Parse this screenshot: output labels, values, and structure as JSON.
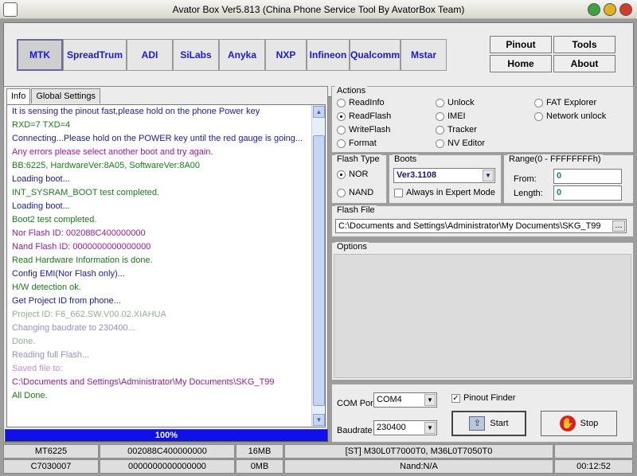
{
  "window": {
    "title": "Avator Box Ver5.813 (China Phone Service Tool By AvatorBox Team)"
  },
  "platforms": [
    "MTK",
    "SpreadTrum",
    "ADI",
    "SiLabs",
    "Anyka",
    "NXP",
    "Infineon",
    "Qualcomm",
    "Mstar"
  ],
  "nav": {
    "pinout": "Pinout",
    "tools": "Tools",
    "home": "Home",
    "about": "About"
  },
  "tabs": [
    "Info",
    "Global Settings"
  ],
  "log": [
    {
      "text": "It is sensing the pinout fast,please hold on the phone Power key",
      "color": "#1a1aa8"
    },
    {
      "text": "RXD=7  TXD=4",
      "color": "#1a7a1a"
    },
    {
      "text": "Connecting...Please hold on the POWER key until the red gauge is going...",
      "color": "#1a1aa8"
    },
    {
      "text": "Any errors please select another boot and try again.",
      "color": "#9a1a9a"
    },
    {
      "text": "BB:6225,     HardwareVer:8A05,     SoftwareVer:8A00",
      "color": "#1a7a1a"
    },
    {
      "text": "Loading boot...",
      "color": "#1a1aa8"
    },
    {
      "text": "INT_SYSRAM_BOOT test completed.",
      "color": "#1a7a1a"
    },
    {
      "text": "Loading boot...",
      "color": "#1a1aa8"
    },
    {
      "text": "Boot2 test completed.",
      "color": "#1a7a1a"
    },
    {
      "text": "Nor Flash ID: 002088C400000000",
      "color": "#9a1a9a"
    },
    {
      "text": "Nand Flash ID: 0000000000000000",
      "color": "#9a1a9a"
    },
    {
      "text": "Read Hardware Information is done.",
      "color": "#1a7a1a"
    },
    {
      "text": "Config EMI(Nor Flash only)...",
      "color": "#1a1aa8"
    },
    {
      "text": "H/W detection ok.",
      "color": "#1a7a1a"
    },
    {
      "text": "Get Project ID from phone...",
      "color": "#1a1aa8"
    },
    {
      "text": "Project ID: F6_662.SW.V00.02.XIAHUA",
      "color": "#90b090"
    },
    {
      "text": "Changing baudrate to 230400...",
      "color": "#9090d0"
    },
    {
      "text": "Done.",
      "color": "#90b090"
    },
    {
      "text": "Reading full Flash...",
      "color": "#9090d0"
    },
    {
      "text": "Saved file to:",
      "color": "#c090c0"
    },
    {
      "text": "C:\\Documents and Settings\\Administrator\\My Documents\\SKG_T99",
      "color": "#9a1a9a"
    },
    {
      "text": "All Done.",
      "color": "#1a7a1a"
    }
  ],
  "progress": {
    "text": "100%",
    "value": 1.0
  },
  "actions": {
    "label": "Actions",
    "items": [
      "ReadInfo",
      "ReadFlash",
      "WriteFlash",
      "Format",
      "Unlock",
      "IMEI",
      "Tracker",
      "NV Editor",
      "FAT Explorer",
      "Network unlock"
    ],
    "selected": "ReadFlash"
  },
  "flash_type": {
    "label": "Flash Type",
    "nor": "NOR",
    "nand": "NAND",
    "selected": "NOR"
  },
  "boots": {
    "label": "Boots",
    "value": "Ver3.1108",
    "expert": "Always in Expert Mode"
  },
  "range": {
    "label": "Range(0 - FFFFFFFFh)",
    "from_label": "From:",
    "from": "0",
    "length_label": "Length:",
    "length": "0"
  },
  "flash_file": {
    "label": "Flash File",
    "path": "C:\\Documents and Settings\\Administrator\\My Documents\\SKG_T99",
    "browse": "..."
  },
  "options": {
    "label": "Options"
  },
  "com": {
    "port_label": "COM Port",
    "port": "COM4",
    "baud_label": "Baudrate",
    "baud": "230400",
    "pinout_finder": "Pinout Finder"
  },
  "buttons": {
    "start": "Start",
    "stop": "Stop"
  },
  "status": {
    "row1": [
      "MT6225",
      "002088C400000000",
      "16MB",
      "[ST] M30L0T7000T0, M36L0T7050T0",
      ""
    ],
    "row2": [
      "C7030007",
      "0000000000000000",
      "0MB",
      "Nand:N/A",
      "00:12:52"
    ]
  }
}
